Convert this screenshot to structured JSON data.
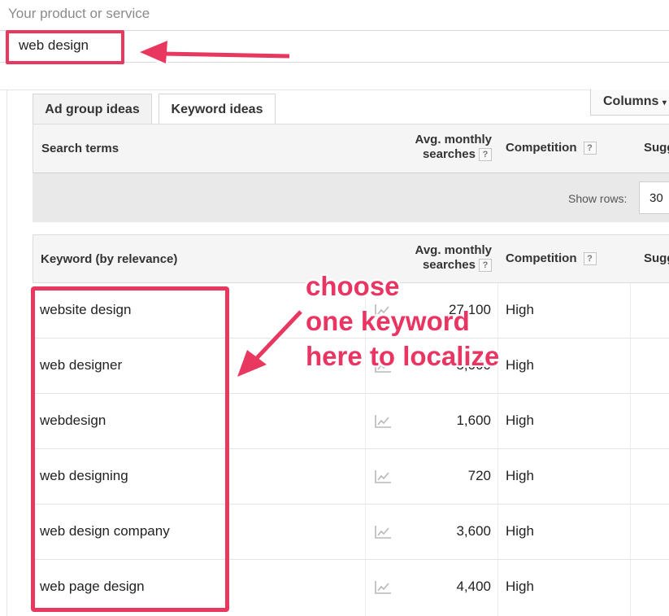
{
  "colors": {
    "highlight": "#e8385f",
    "annotation_text": "#ea3563",
    "header_bg": "#f5f5f5"
  },
  "product": {
    "label": "Your product or service",
    "value": "web design"
  },
  "tabs": [
    {
      "label": "Ad group ideas",
      "active": false
    },
    {
      "label": "Keyword ideas",
      "active": true
    }
  ],
  "columns_button": {
    "label": "Columns",
    "icon": "caret-down-icon"
  },
  "search_terms_header": {
    "col1": "Search terms",
    "col2_line1": "Avg. monthly",
    "col2_line2": "searches",
    "col3": "Competition",
    "col4": "Sugg",
    "help": "?"
  },
  "show_rows": {
    "label": "Show rows:",
    "value": "30"
  },
  "keyword_header": {
    "col1": "Keyword (by relevance)",
    "col2_line1": "Avg. monthly",
    "col2_line2": "searches",
    "col3": "Competition",
    "col4": "Sugg",
    "help": "?"
  },
  "keywords": [
    {
      "keyword": "website design",
      "searches": "27,100",
      "competition": "High",
      "icon": "trend-chart-icon"
    },
    {
      "keyword": "web designer",
      "searches": "5,000",
      "competition": "High",
      "icon": "trend-chart-icon"
    },
    {
      "keyword": "webdesign",
      "searches": "1,600",
      "competition": "High",
      "icon": "trend-chart-icon"
    },
    {
      "keyword": "web designing",
      "searches": "720",
      "competition": "High",
      "icon": "trend-chart-icon"
    },
    {
      "keyword": "web design company",
      "searches": "3,600",
      "competition": "High",
      "icon": "trend-chart-icon"
    },
    {
      "keyword": "web page design",
      "searches": "4,400",
      "competition": "High",
      "icon": "trend-chart-icon"
    }
  ],
  "annotation": {
    "text": "choose\none keyword\nhere to localize"
  }
}
